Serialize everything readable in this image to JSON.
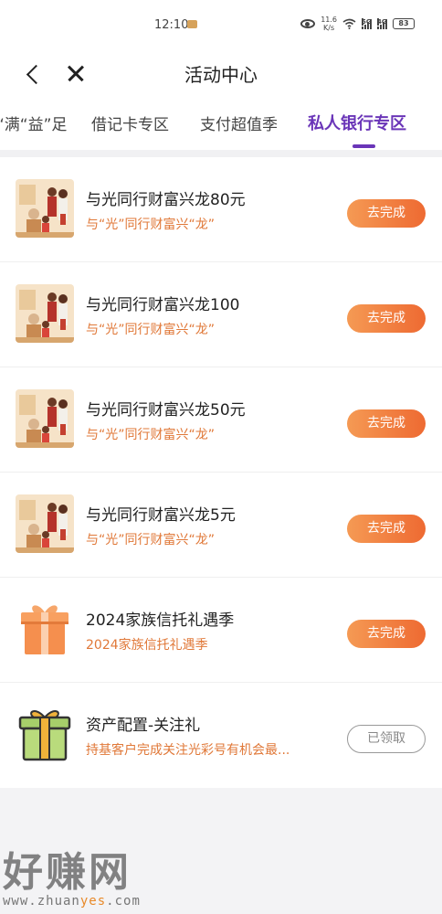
{
  "status_bar": {
    "time": "12:10",
    "net_speed_value": "11.6",
    "net_speed_unit": "K/s",
    "signal1_label": "5G",
    "signal2_label": "4G",
    "battery": "83"
  },
  "header": {
    "title": "活动中心"
  },
  "tabs": [
    {
      "label": "“满“益”足",
      "active": false
    },
    {
      "label": "借记卡专区",
      "active": false
    },
    {
      "label": "支付超值季",
      "active": false
    },
    {
      "label": "私人银行专区",
      "active": true
    }
  ],
  "tasks": [
    {
      "title": "与光同行财富兴龙80元",
      "subtitle": "与“光”同行财富兴“龙”",
      "button": "去完成",
      "icon": "family-illustration-icon"
    },
    {
      "title": "与光同行财富兴龙100",
      "subtitle": "与“光”同行财富兴“龙”",
      "button": "去完成",
      "icon": "family-illustration-icon"
    },
    {
      "title": "与光同行财富兴龙50元",
      "subtitle": "与“光”同行财富兴“龙”",
      "button": "去完成",
      "icon": "family-illustration-icon"
    },
    {
      "title": "与光同行财富兴龙5元",
      "subtitle": "与“光”同行财富兴“龙”",
      "button": "去完成",
      "icon": "family-illustration-icon"
    },
    {
      "title": "2024家族信托礼遇季",
      "subtitle": "2024家族信托礼遇季",
      "button": "去完成",
      "icon": "orange-gift-box-icon"
    },
    {
      "title": "资产配置-关注礼",
      "subtitle": "持基客户完成关注光彩号有机会最...",
      "button": "已领取",
      "icon": "green-gift-box-icon"
    }
  ],
  "watermark": {
    "title": "好赚网",
    "url_prefix": "www.zhuan",
    "url_accent": "yes",
    "url_suffix": ".com"
  },
  "colors": {
    "accent_purple": "#6a35b8",
    "button_orange": "#ee6a32",
    "subtitle_orange": "#e07838"
  }
}
